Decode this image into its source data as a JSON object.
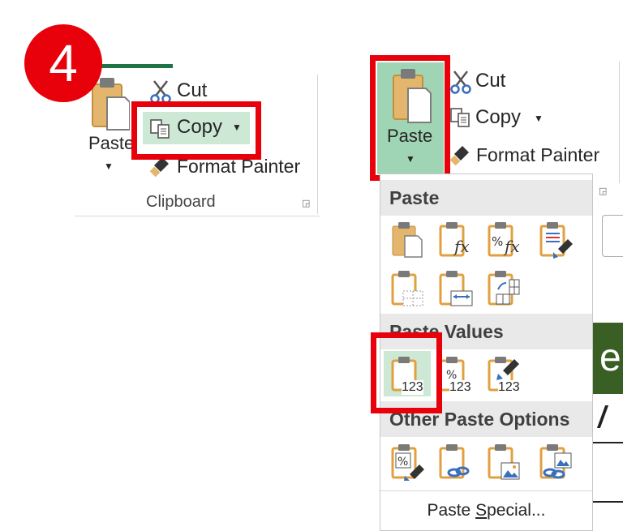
{
  "step": {
    "number": "4"
  },
  "left_ribbon": {
    "paste_label": "Paste",
    "cut_label": "Cut",
    "copy_label": "Copy",
    "format_painter_label": "Format Painter",
    "group_label": "Clipboard"
  },
  "right_ribbon": {
    "paste_label": "Paste",
    "cut_label": "Cut",
    "copy_label": "Copy",
    "format_painter_label": "Format Painter"
  },
  "dropdown": {
    "paste_heading": "Paste",
    "paste_values_heading": "Paste Values",
    "other_heading": "Other Paste Options",
    "paste_special_prefix": "Paste ",
    "paste_special_s": "S",
    "paste_special_rest": "pecial...",
    "value_badge": "123"
  },
  "sheet": {
    "band_letter": "e"
  },
  "colors": {
    "highlight": "#e8000a",
    "accent": "#217346",
    "selection": "#cde8d5",
    "band": "#3a5f24"
  }
}
